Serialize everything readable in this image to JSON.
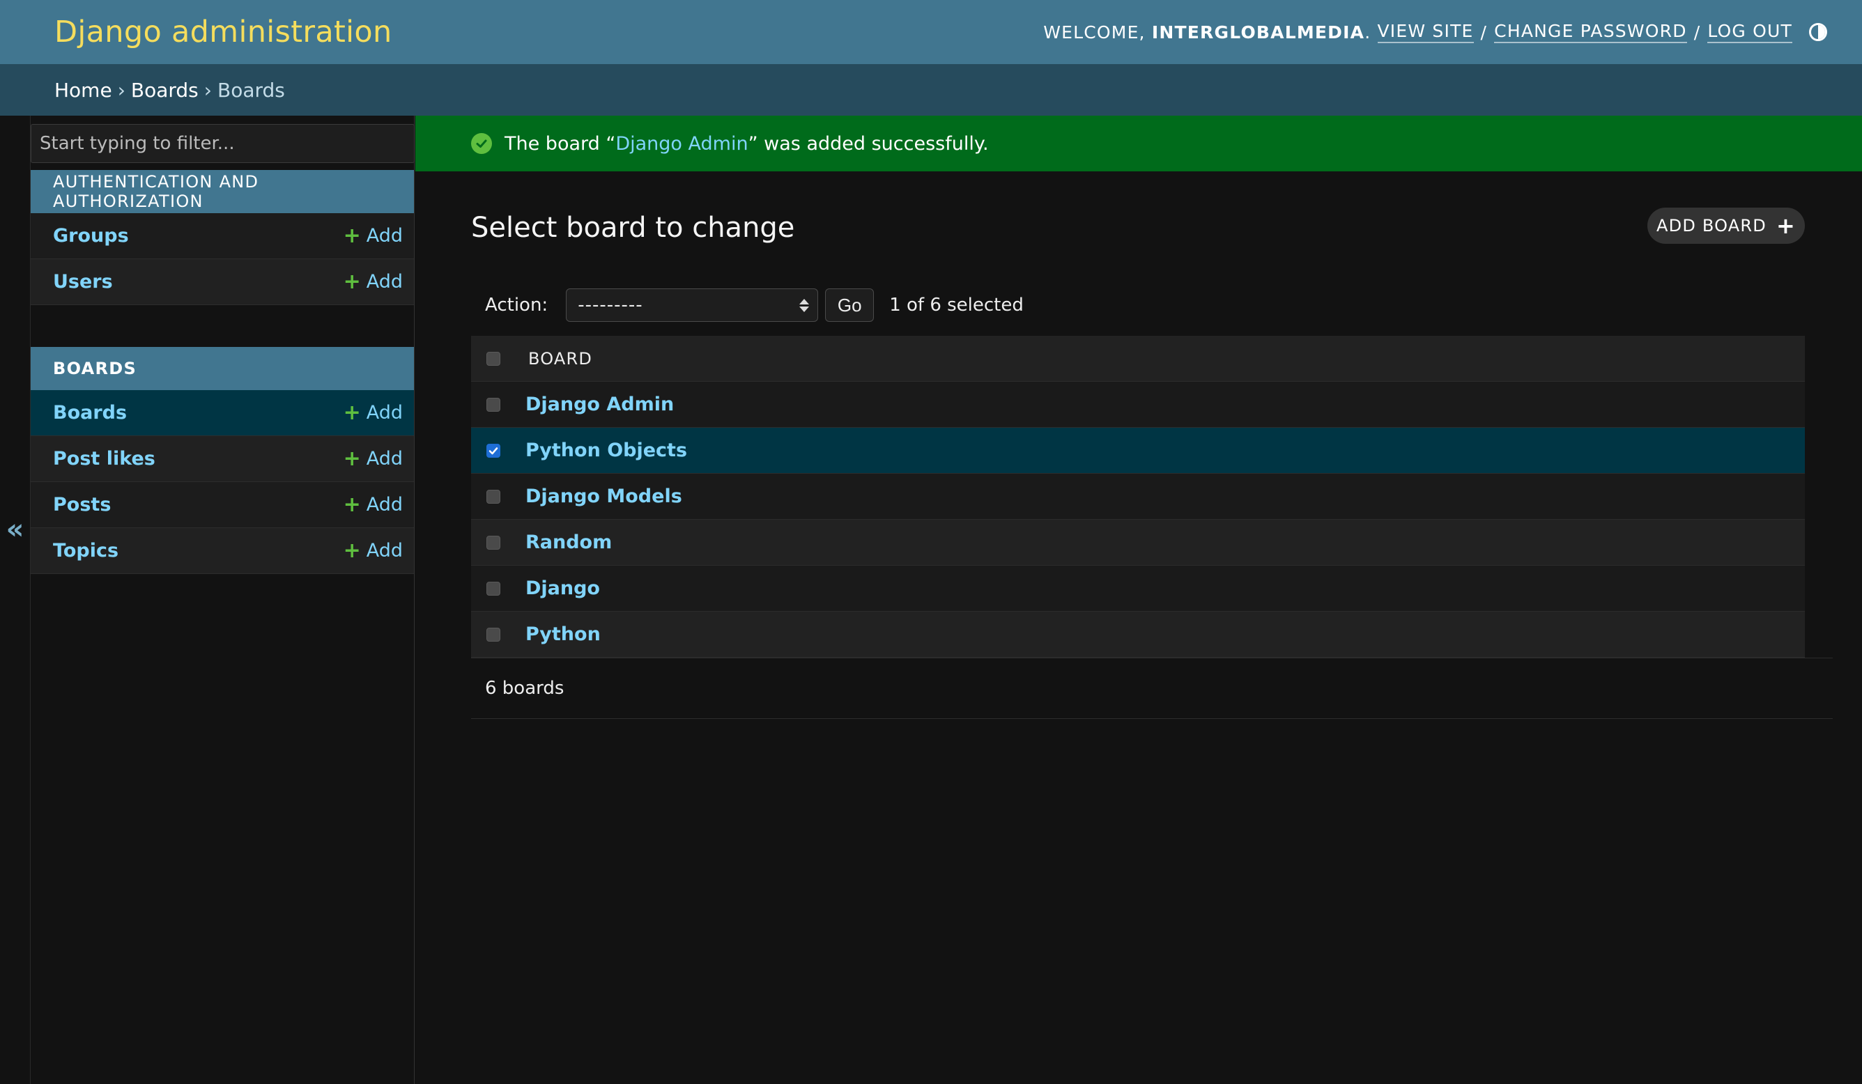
{
  "header": {
    "site_name": "Django administration",
    "welcome": "Welcome,",
    "username": "interglobalmedia",
    "period": ".",
    "view_site": "View site",
    "change_password": "Change password",
    "log_out": "Log out",
    "separator": "/",
    "theme_icon": "half-circle-icon"
  },
  "breadcrumbs": {
    "items": [
      "Home",
      "Boards",
      "Boards"
    ],
    "separator": "›"
  },
  "sidebar": {
    "filter_placeholder": "Start typing to filter...",
    "collapse_icon": "«",
    "add_label": "Add",
    "modules": [
      {
        "caption": "Authentication and Authorization",
        "models": [
          {
            "name": "Groups"
          },
          {
            "name": "Users"
          }
        ]
      },
      {
        "caption": "Boards",
        "models": [
          {
            "name": "Boards",
            "current": true
          },
          {
            "name": "Post likes"
          },
          {
            "name": "Posts"
          },
          {
            "name": "Topics"
          }
        ]
      }
    ]
  },
  "message": {
    "prefix": "The board “",
    "link": "Django Admin",
    "suffix": "” was added successfully."
  },
  "content": {
    "title": "Select board to change",
    "add_button": "Add board",
    "action_label": "Action:",
    "action_selected": "---------",
    "go_label": "Go",
    "counter": "1 of 6 selected",
    "column_header": "Board",
    "rows": [
      {
        "name": "Django Admin",
        "checked": false
      },
      {
        "name": "Python Objects",
        "checked": true
      },
      {
        "name": "Django Models",
        "checked": false
      },
      {
        "name": "Random",
        "checked": false
      },
      {
        "name": "Django",
        "checked": false
      },
      {
        "name": "Python",
        "checked": false
      }
    ],
    "paginator": "6 boards"
  },
  "colors": {
    "header_bg": "#417690",
    "breadcrumb_bg": "#264b5d",
    "site_name": "#f5dd5d",
    "link": "#81d4fa",
    "success_bg": "#006b1b",
    "selected_row": "#003544"
  }
}
